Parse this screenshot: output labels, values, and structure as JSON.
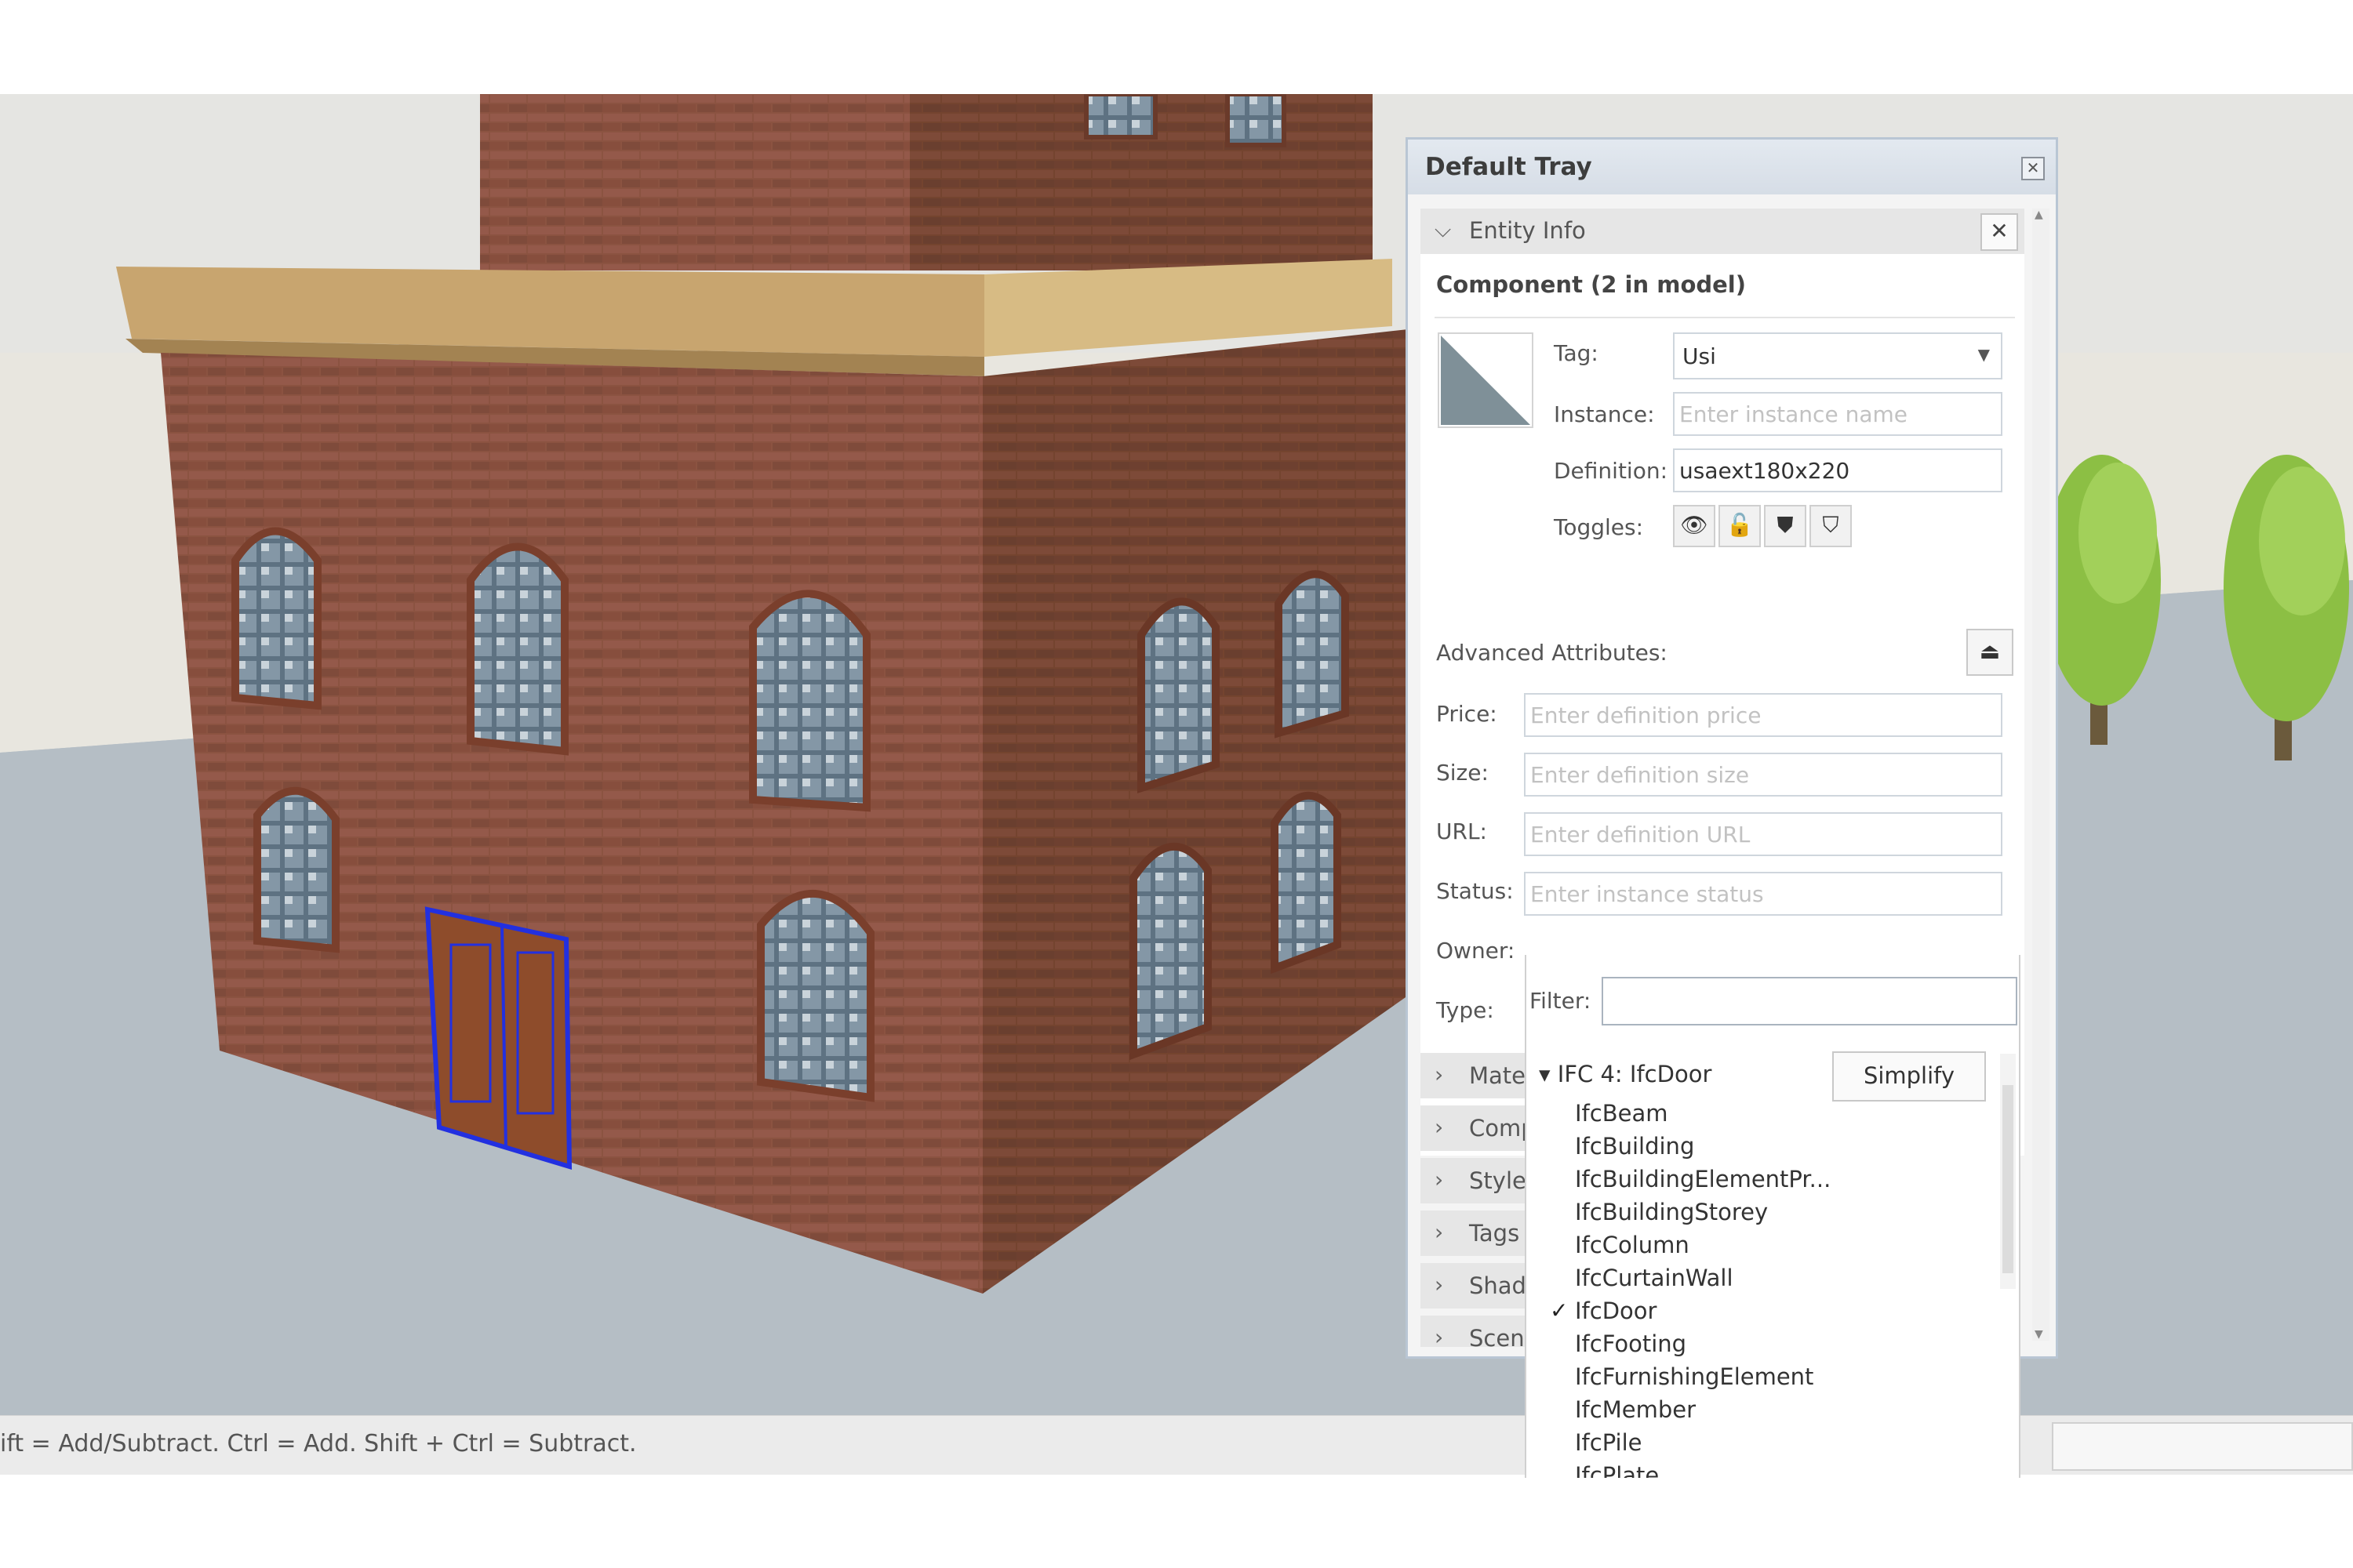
{
  "status_bar": {
    "text": "ift = Add/Subtract. Ctrl = Add. Shift + Ctrl = Subtract."
  },
  "tray": {
    "title": "Default Tray",
    "close_glyph": "✕",
    "entity_info": {
      "header": "Entity Info",
      "close_glyph": "✕",
      "component_title": "Component (2 in model)",
      "labels": {
        "tag": "Tag:",
        "instance": "Instance:",
        "definition": "Definition:",
        "toggles": "Toggles:"
      },
      "tag_value": "Usi",
      "instance_placeholder": "Enter instance name",
      "definition_value": "usaext180x220",
      "toggles": [
        {
          "icon": "eye-icon",
          "glyph": "👁"
        },
        {
          "icon": "unlock-icon",
          "glyph": "🔓"
        },
        {
          "icon": "cast-shadows-icon",
          "glyph": "⛊"
        },
        {
          "icon": "receive-shadows-icon",
          "glyph": "⛉"
        }
      ],
      "advanced_attributes_label": "Advanced Attributes:",
      "advanced_button_glyph": "⏏",
      "advanced": {
        "price_label": "Price:",
        "price_placeholder": "Enter definition price",
        "size_label": "Size:",
        "size_placeholder": "Enter definition size",
        "url_label": "URL:",
        "url_placeholder": "Enter definition URL",
        "status_label": "Status:",
        "status_placeholder": "Enter instance status",
        "owner_label": "Owner:",
        "type_label": "Type:"
      }
    },
    "collapsed_sections": [
      "Materials",
      "Components",
      "Styles",
      "Tags",
      "Shadows",
      "Scenes"
    ]
  },
  "type_dropdown": {
    "filter_label": "Filter:",
    "filter_value": "",
    "group": "IFC 4: IfcDoor",
    "simplify_label": "Simplify",
    "items": [
      {
        "label": "IfcBeam",
        "checked": false
      },
      {
        "label": "IfcBuilding",
        "checked": false
      },
      {
        "label": "IfcBuildingElementPr...",
        "checked": false
      },
      {
        "label": "IfcBuildingStorey",
        "checked": false
      },
      {
        "label": "IfcColumn",
        "checked": false
      },
      {
        "label": "IfcCurtainWall",
        "checked": false
      },
      {
        "label": "IfcDoor",
        "checked": true
      },
      {
        "label": "IfcFooting",
        "checked": false
      },
      {
        "label": "IfcFurnishingElement",
        "checked": false
      },
      {
        "label": "IfcMember",
        "checked": false
      },
      {
        "label": "IfcPile",
        "checked": false
      },
      {
        "label": "IfcPlate",
        "checked": false
      }
    ]
  },
  "colors": {
    "brick": "#8a5442",
    "roof_trim": "#c9a874",
    "sky": "#e3e3df",
    "ground": "#b5bec5",
    "window_glass": "#6f8494",
    "door": "#8a4b2b",
    "selection": "#1f2bd6",
    "tree": "#7bb33a"
  }
}
